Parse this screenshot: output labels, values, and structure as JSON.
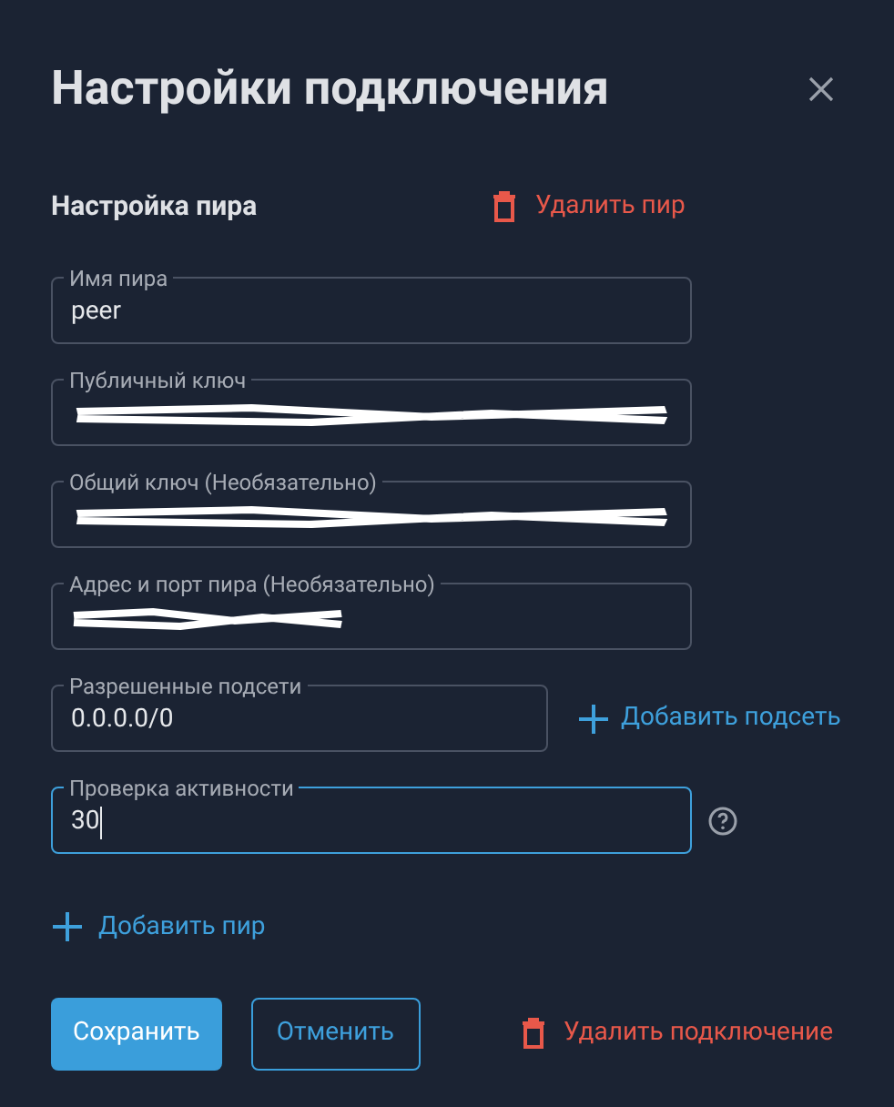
{
  "dialog": {
    "title": "Настройки подключения"
  },
  "peer_section": {
    "heading": "Настройка пира",
    "delete_label": "Удалить пир"
  },
  "fields": [
    {
      "kind": "plain",
      "label": "Имя пира",
      "value": "peer",
      "redacted": false,
      "focused": false
    },
    {
      "kind": "plain",
      "label": "Публичный ключ",
      "redacted": true,
      "focused": false
    },
    {
      "kind": "plain",
      "label": "Общий ключ (Необязательно)",
      "redacted": true,
      "focused": false
    },
    {
      "kind": "plain",
      "label": "Адрес и порт пира (Необязательно)",
      "redacted": true,
      "focused": false
    },
    {
      "kind": "with-action",
      "label": "Разрешенные подсети",
      "value": "0.0.0.0/0",
      "action": "Добавить подсеть",
      "redacted": false,
      "focused": false
    },
    {
      "kind": "with-help",
      "label": "Проверка активности",
      "value": "30",
      "redacted": false,
      "focused": true
    }
  ],
  "add_peer": "Добавить пир",
  "buttons": {
    "save": "Сохранить",
    "cancel": "Отменить",
    "delete_connection": "Удалить подключение"
  }
}
